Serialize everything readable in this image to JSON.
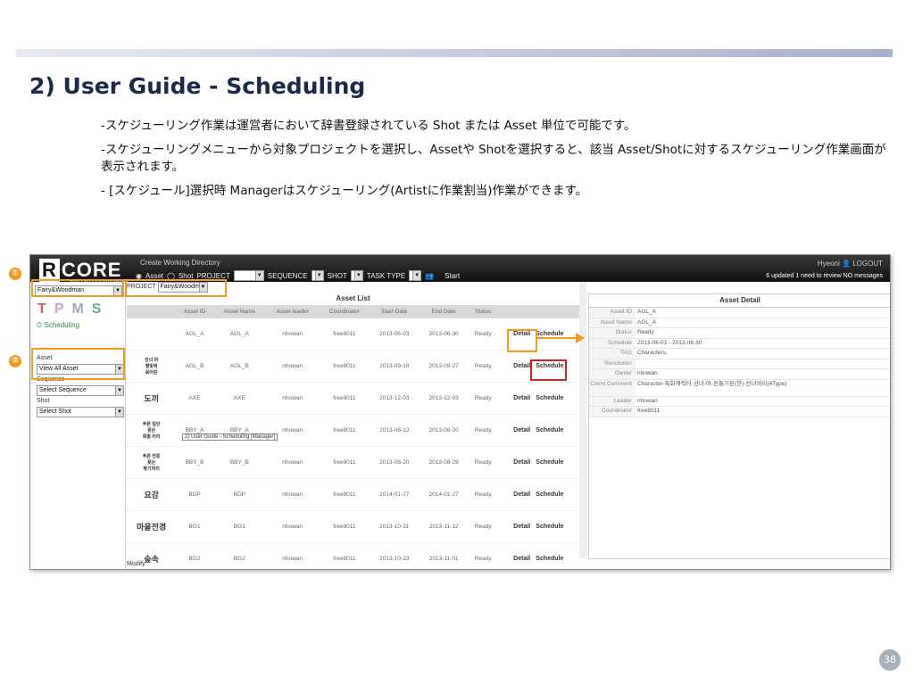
{
  "slide": {
    "title": "2) User Guide - Scheduling",
    "bullets": [
      "-スケジューリング作業は運営者において辞書登録されている Shot または Asset 単位で可能です。",
      "-スケジューリングメニューから対象プロジェクトを選択し、Assetや Shotを選択すると、該当 Asset/Shotに対するスケジューリング作業画面が表示されます。",
      "- [スケジュール]選択時 Managerはスケジューリング(Artistに作業割当)作業ができます。"
    ],
    "page_number": "38",
    "badges": [
      "①",
      "②"
    ],
    "colors": {
      "accent": "#f39a1e",
      "highlight": "#d81e1e",
      "header": "#1a2a4a"
    }
  },
  "app": {
    "logo": "CORE",
    "logo_prefix": "R",
    "logo_sub": "ENTERTAINMENT",
    "create_dir": "Create Working Directory",
    "radio_asset": "Asset",
    "radio_shot": "Shot",
    "project_label": "PROJECT",
    "sequence_label": "SEQUENCE",
    "shot_label": "SHOT",
    "tasktype_label": "TASK TYPE",
    "start": "Start",
    "user": "Hyeoni",
    "logout": "LOGOUT",
    "messages": "6 updated  1 need to review  NO messages",
    "sidebar": {
      "project_value": "Fairy&Woodman",
      "tpms": "TPMS",
      "scheduling": "Scheduling",
      "asset_label": "Asset",
      "asset_value": "View All Asset",
      "sequence_label": "Sequence",
      "sequence_value": "Select Sequence",
      "shot_label": "Shot",
      "shot_value": "Select Shot"
    },
    "project_filter_label": "PROJECT",
    "project_filter_value": "Fairy&Woodman",
    "asset_list_title": "Asset List",
    "columns": [
      "",
      "Asset ID",
      "Asset Name",
      "Asset leader",
      "Coordinator",
      "Start Date",
      "End Date",
      "Status",
      ""
    ],
    "rows": [
      {
        "img": "",
        "id": "AGL_A",
        "name": "AGL_A",
        "leader": "nhowan",
        "coord": "free8011",
        "start": "2013-06-03",
        "end": "2013-06-30",
        "status": "Ready"
      },
      {
        "img": "선녀 머\n별빛에\n묶어란",
        "id": "AGL_B",
        "name": "AGL_B",
        "leader": "nhowan",
        "coord": "free8011",
        "start": "2013-09-18",
        "end": "2013-09-27",
        "status": "Ready"
      },
      {
        "img": "도끼",
        "id": "AXE",
        "name": "AXE",
        "leader": "nhowan",
        "coord": "free8011",
        "start": "2013-12-03",
        "end": "2013-12-03",
        "status": "Ready"
      },
      {
        "img": "푸른 일반\n꽃은\n특별 머리",
        "id": "BBY_A",
        "name": "BBY_A",
        "leader": "nhowan",
        "coord": "free8011",
        "start": "2013-08-12",
        "end": "2013-08-20",
        "status": "Ready"
      },
      {
        "img": "푸른 전통\n꽃은\n땋기머리",
        "id": "BBY_B",
        "name": "BBY_B",
        "leader": "nhowan",
        "coord": "free8011",
        "start": "2013-08-20",
        "end": "2013-08-28",
        "status": "Ready"
      },
      {
        "img": "요강",
        "id": "BDP",
        "name": "BDP",
        "leader": "nhowan",
        "coord": "free8011",
        "start": "2014-01-27",
        "end": "2014-01-27",
        "status": "Ready"
      },
      {
        "img": "마을전경",
        "id": "BG1",
        "name": "BG1",
        "leader": "nhowan",
        "coord": "free8011",
        "start": "2013-10-31",
        "end": "2013-11-12",
        "status": "Ready"
      },
      {
        "img": "숲속",
        "id": "BG2",
        "name": "BG2",
        "leader": "nhowan",
        "coord": "free8011",
        "start": "2013-10-23",
        "end": "2013-11-01",
        "status": "Ready"
      }
    ],
    "detail_label": "Detail",
    "schedule_label": "Schedule",
    "tooltip": "2) User Guide - Scheduling [Manager]",
    "modify": "Modify",
    "asset_detail_title": "Asset Detail",
    "detail": [
      {
        "k": "Asset ID",
        "v": "AGL_A"
      },
      {
        "k": "Asset Name",
        "v": "AGL_A"
      },
      {
        "k": "Status",
        "v": "Ready"
      },
      {
        "k": "Schedule",
        "v": "2013-06-03 - 2013-06-30"
      },
      {
        "k": "TAG",
        "v": "Characters,"
      },
      {
        "k": "Resolution",
        "v": ""
      },
      {
        "k": "Owner",
        "v": "nhowan"
      },
      {
        "k": "Client Comment",
        "v": "Character-특화캐릭터-선녀-여-전통기본(한)-선녀머리(4Type)"
      },
      {
        "k": "Leader",
        "v": "nhowan"
      },
      {
        "k": "Coordinator",
        "v": "free8011"
      }
    ]
  }
}
